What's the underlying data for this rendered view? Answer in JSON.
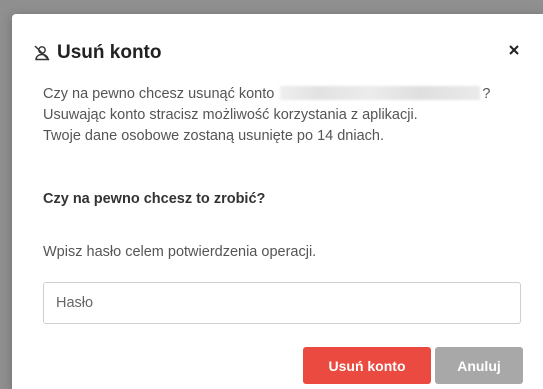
{
  "dialog": {
    "icon": "user-slash-icon",
    "title": "Usuń konto",
    "close_icon": "close-icon",
    "text_prefix": "Czy na pewno chcesz usunąć konto",
    "text_suffix": "?",
    "text_line2": "Usuwając konto stracisz możliwość korzystania z aplikacji.",
    "text_line3": "Twoje dane osobowe zostaną usunięte po 14 dniach.",
    "question": "Czy na pewno chcesz to zrobić?",
    "hint": "Wpisz hasło celem potwierdzenia operacji.",
    "password_placeholder": "Hasło",
    "password_value": "",
    "delete_label": "Usuń konto",
    "cancel_label": "Anuluj"
  },
  "colors": {
    "danger": "#ea4a3f",
    "cancel": "#a8a8a8",
    "overlay": "#8f8f8f"
  }
}
